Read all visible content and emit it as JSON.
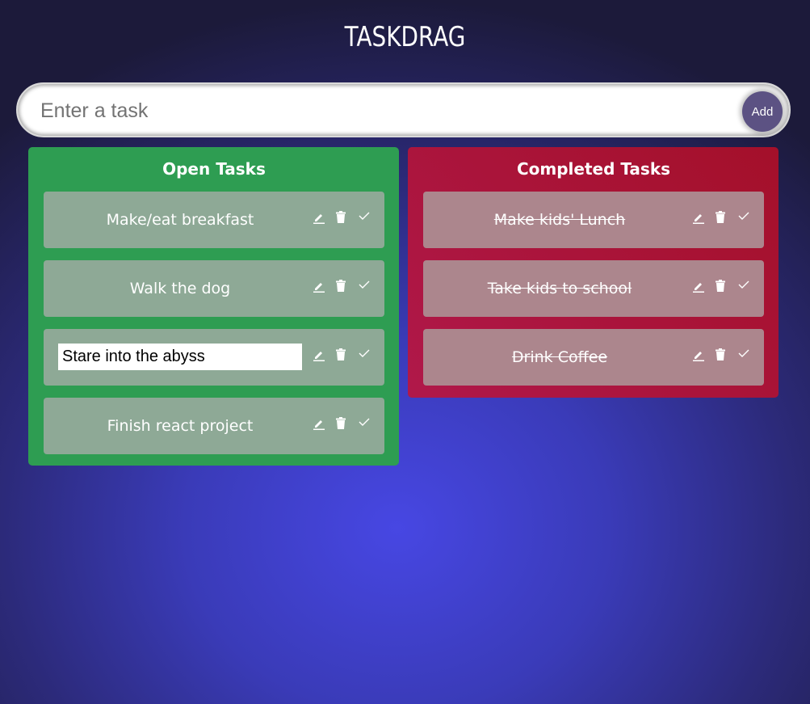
{
  "app": {
    "title": "TASKDRAG"
  },
  "new_task": {
    "placeholder": "Enter a task",
    "value": "",
    "add_label": "Add"
  },
  "columns": {
    "open": {
      "title": "Open Tasks",
      "color": "#2e9d52",
      "tasks": [
        {
          "text": "Make/eat breakfast",
          "editing": false
        },
        {
          "text": "Walk the dog",
          "editing": false
        },
        {
          "text": "Stare into the abyss",
          "editing": true
        },
        {
          "text": "Finish react project",
          "editing": false
        }
      ]
    },
    "completed": {
      "title": "Completed Tasks",
      "color": "#a8123a",
      "tasks": [
        {
          "text": "Make kids' Lunch"
        },
        {
          "text": "Take kids to school"
        },
        {
          "text": "Drink Coffee"
        }
      ]
    }
  },
  "icons": {
    "edit": "pencil-icon",
    "delete": "trash-icon",
    "complete": "check-icon"
  }
}
